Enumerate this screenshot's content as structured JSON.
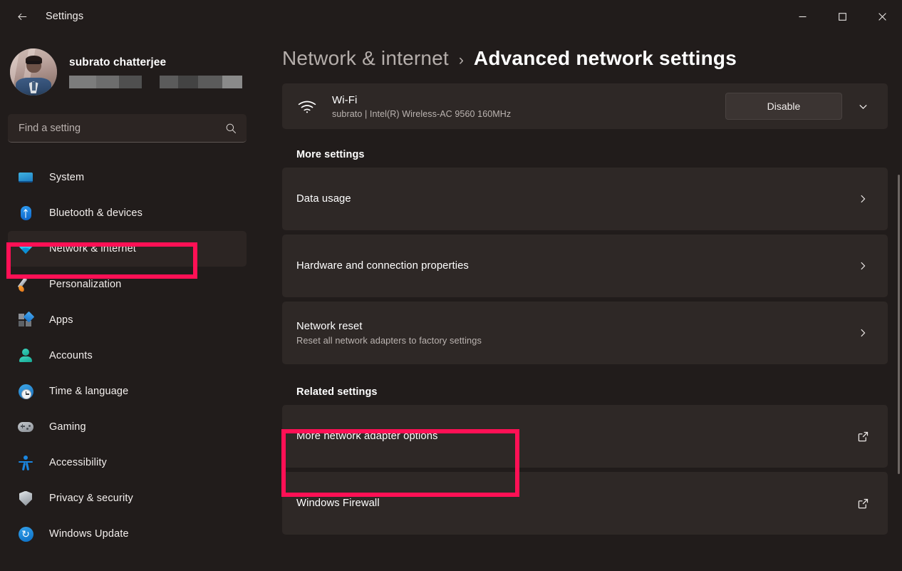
{
  "window": {
    "title": "Settings",
    "back_icon": "back-arrow-icon",
    "minimize_label": "Minimize",
    "maximize_label": "Maximize",
    "close_label": "Close"
  },
  "sidebar": {
    "profile": {
      "name": "subrato chatterjee",
      "avatar_alt": "user-avatar",
      "redacted_email": true
    },
    "search": {
      "placeholder": "Find a setting",
      "value": "",
      "icon": "search-icon"
    },
    "items": [
      {
        "label": "System",
        "icon": "monitor-icon",
        "selected": false
      },
      {
        "label": "Bluetooth & devices",
        "icon": "bluetooth-icon",
        "selected": false
      },
      {
        "label": "Network & internet",
        "icon": "wifi-icon",
        "selected": true
      },
      {
        "label": "Personalization",
        "icon": "paintbrush-icon",
        "selected": false
      },
      {
        "label": "Apps",
        "icon": "apps-icon",
        "selected": false
      },
      {
        "label": "Accounts",
        "icon": "person-icon",
        "selected": false
      },
      {
        "label": "Time & language",
        "icon": "clock-globe-icon",
        "selected": false
      },
      {
        "label": "Gaming",
        "icon": "gamepad-icon",
        "selected": false
      },
      {
        "label": "Accessibility",
        "icon": "accessibility-icon",
        "selected": false
      },
      {
        "label": "Privacy & security",
        "icon": "shield-icon",
        "selected": false
      },
      {
        "label": "Windows Update",
        "icon": "update-icon",
        "selected": false
      }
    ]
  },
  "breadcrumb": {
    "parent": "Network & internet",
    "separator": "›",
    "current": "Advanced network settings"
  },
  "adapter": {
    "icon": "wifi-signal-icon",
    "name": "Wi-Fi",
    "details": "subrato | Intel(R) Wireless-AC 9560 160MHz",
    "action_label": "Disable",
    "expand_icon": "chevron-down-icon"
  },
  "more_settings": {
    "heading": "More settings",
    "rows": [
      {
        "title": "Data usage",
        "subtitle": "",
        "action": "chevron-right-icon"
      },
      {
        "title": "Hardware and connection properties",
        "subtitle": "",
        "action": "chevron-right-icon"
      },
      {
        "title": "Network reset",
        "subtitle": "Reset all network adapters to factory settings",
        "action": "chevron-right-icon"
      }
    ]
  },
  "related_settings": {
    "heading": "Related settings",
    "rows": [
      {
        "title": "More network adapter options",
        "subtitle": "",
        "action": "external-link-icon",
        "highlighted": true
      },
      {
        "title": "Windows Firewall",
        "subtitle": "",
        "action": "external-link-icon",
        "highlighted": false
      }
    ]
  },
  "highlights": {
    "color": "#ff1055",
    "targets": [
      "Network & internet",
      "More network adapter options"
    ]
  }
}
